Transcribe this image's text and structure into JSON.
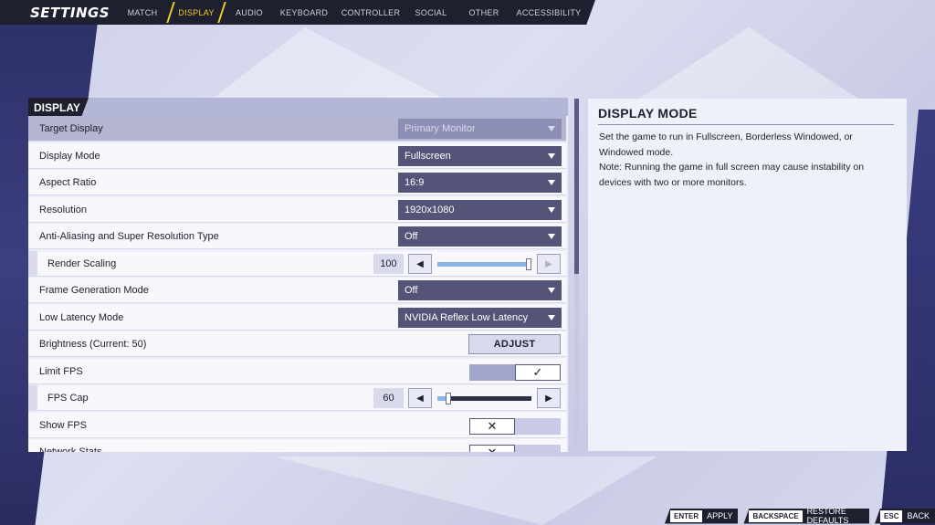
{
  "header": {
    "title": "SETTINGS",
    "tabs": [
      "MATCH",
      "DISPLAY",
      "AUDIO",
      "KEYBOARD",
      "CONTROLLER",
      "SOCIAL",
      "OTHER",
      "ACCESSIBILITY"
    ],
    "active_tab": "DISPLAY"
  },
  "section": {
    "title": "DISPLAY"
  },
  "rows": {
    "target_display": {
      "label": "Target Display",
      "value": "Primary Monitor"
    },
    "display_mode": {
      "label": "Display Mode",
      "value": "Fullscreen"
    },
    "aspect_ratio": {
      "label": "Aspect Ratio",
      "value": "16:9"
    },
    "resolution": {
      "label": "Resolution",
      "value": "1920x1080"
    },
    "anti_aliasing": {
      "label": "Anti-Aliasing and Super Resolution Type",
      "value": "Off"
    },
    "render_scaling": {
      "label": "Render Scaling",
      "value": "100",
      "level": 1.0
    },
    "frame_generation": {
      "label": "Frame Generation Mode",
      "value": "Off"
    },
    "low_latency": {
      "label": "Low Latency Mode",
      "value": "NVIDIA Reflex Low Latency"
    },
    "brightness": {
      "label": "Brightness (Current: 50)",
      "button": "ADJUST"
    },
    "limit_fps": {
      "label": "Limit FPS",
      "enabled": true
    },
    "fps_cap": {
      "label": "FPS Cap",
      "value": "60",
      "level": 0.12
    },
    "show_fps": {
      "label": "Show FPS",
      "enabled": false
    },
    "network_stats": {
      "label": "Network Stats",
      "enabled": false
    }
  },
  "info": {
    "title": "DISPLAY MODE",
    "line1": "Set the game to run in Fullscreen, Borderless Windowed, or Windowed mode.",
    "line2": "Note: Running the game in full screen may cause instability on devices with two or more monitors."
  },
  "footer": {
    "apply_key": "ENTER",
    "apply_label": "APPLY",
    "restore_key": "BACKSPACE",
    "restore_label": "RESTORE DEFAULTS",
    "back_key": "ESC",
    "back_label": "BACK"
  },
  "icons": {
    "check": "✓",
    "cross": "✕",
    "left": "◀",
    "right": "▶"
  },
  "colors": {
    "accent": "#f0d020",
    "dropdown": "#535478",
    "dark": "#1e2030",
    "slider_fill": "#8ab4e8"
  }
}
